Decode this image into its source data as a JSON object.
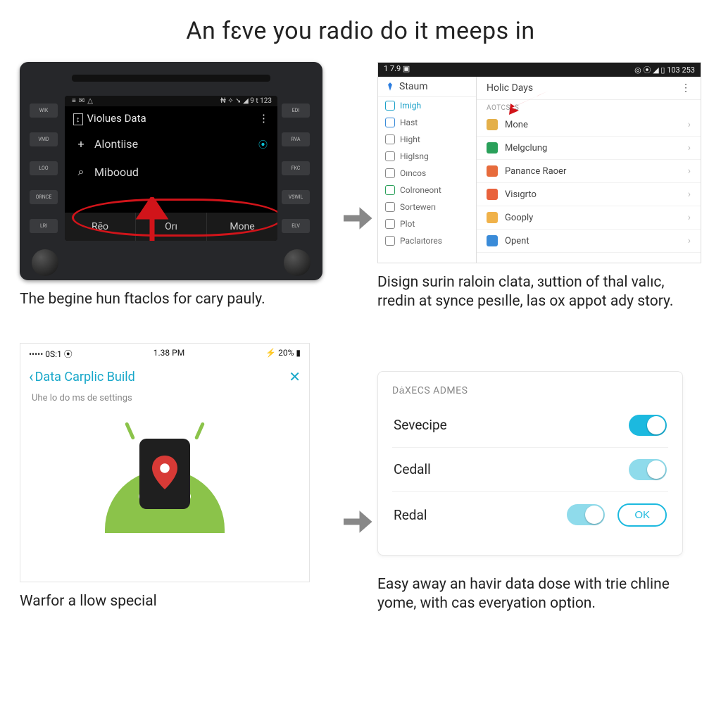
{
  "title": "An fɛve you radio do it meeps in",
  "panel1": {
    "status_left_icons": [
      "menu-icon",
      "mail-icon",
      "warning-icon"
    ],
    "status_right": "9 t 123",
    "screen_title_icon": "↕",
    "screen_title": "Violues Data",
    "row1_icon": "+",
    "row1": "Alontiise",
    "row1_badge": "⦿",
    "row2_icon": "⌕",
    "row2": "Mibooud",
    "tab1": "Rēo",
    "tab2": "Orı",
    "tab3": "Mone",
    "side_left": [
      "WIK",
      "VMD",
      "LOO",
      "ORNCE",
      "LRI"
    ],
    "side_right": [
      "EDI",
      "RVA",
      "FKC",
      "VSWIL",
      "ELV"
    ],
    "caption": "The begine  hun ftaclos for cary pauly."
  },
  "panel2": {
    "status_left": "1 7.9  ▣",
    "status_right": "◎ ⦿ ◢ ▯ 103  253",
    "side_header": "Staum",
    "side_items": [
      {
        "icon": "#1aa0c8",
        "label": "Imigh",
        "active": true
      },
      {
        "icon": "#3a8bd8",
        "label": "Hast"
      },
      {
        "icon": "#888",
        "label": "Hight"
      },
      {
        "icon": "#888",
        "label": "Higlsng"
      },
      {
        "icon": "#888",
        "label": "Oıncos"
      },
      {
        "icon": "#2aa05a",
        "label": "Colroneont"
      },
      {
        "icon": "#888",
        "label": "Sortewerı"
      },
      {
        "icon": "#888",
        "label": "Plot"
      },
      {
        "icon": "#888",
        "label": "Paclaıtores"
      }
    ],
    "main_header": "Holic Days",
    "section": "AOTCSLS",
    "rows": [
      {
        "color": "#e4b04a",
        "label": "Mone"
      },
      {
        "color": "#2aa05a",
        "label": "Melgclung"
      },
      {
        "color": "#e76b3c",
        "label": "Panance Raoer"
      },
      {
        "color": "#e9623c",
        "label": "Visıgrto"
      },
      {
        "color": "#f0b24a",
        "label": "Gooply"
      },
      {
        "color": "#3a8bd8",
        "label": "Opent"
      }
    ],
    "caption": "Disign surin raloin clata, ɜuttion of thal valıc, rredin at synce pesılle, las ox appot ady story."
  },
  "panel3": {
    "carrier": "••••• 0S:1 ⦿",
    "time": "1.38 PM",
    "batt": "⚡ 20% ▮",
    "back": "Data Carplic Build",
    "close": "✕",
    "subtitle": "Uhe lo do ms de settings",
    "caption": "Warfor a llow special"
  },
  "panel4": {
    "header": "DȧXECS ADMES",
    "rows": [
      {
        "label": "Sevecipe",
        "on": true
      },
      {
        "label": "Cedall",
        "on": true
      },
      {
        "label": "Redal",
        "on": true
      }
    ],
    "ok": "OK",
    "caption": "Easy away an havir data dose with trie chline yome, with cas everyation option."
  }
}
